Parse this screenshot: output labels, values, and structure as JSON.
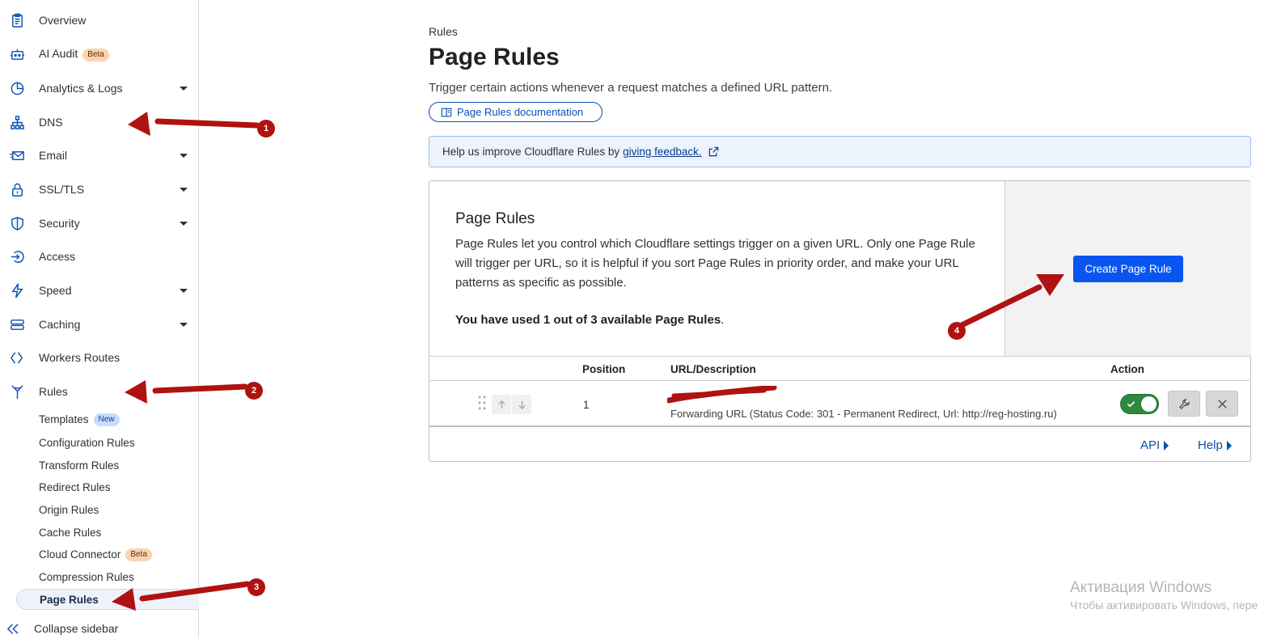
{
  "sidebar": {
    "items": [
      {
        "label": "Overview",
        "icon": "clipboard-icon"
      },
      {
        "label": "AI Audit",
        "icon": "robot-icon",
        "badge": "Beta"
      },
      {
        "label": "Analytics & Logs",
        "icon": "pie-chart-icon",
        "caret": true
      },
      {
        "label": "DNS",
        "icon": "network-icon",
        "caret": true
      },
      {
        "label": "Email",
        "icon": "envelope-icon",
        "caret": true
      },
      {
        "label": "SSL/TLS",
        "icon": "lock-icon",
        "caret": true
      },
      {
        "label": "Security",
        "icon": "shield-icon",
        "caret": true
      },
      {
        "label": "Access",
        "icon": "access-icon"
      },
      {
        "label": "Speed",
        "icon": "lightning-icon",
        "caret": true
      },
      {
        "label": "Caching",
        "icon": "storage-icon",
        "caret": true
      },
      {
        "label": "Workers Routes",
        "icon": "workers-icon"
      },
      {
        "label": "Rules",
        "icon": "rules-icon"
      }
    ],
    "subitems": [
      {
        "label": "Templates",
        "badge": "New"
      },
      {
        "label": "Configuration Rules"
      },
      {
        "label": "Transform Rules"
      },
      {
        "label": "Redirect Rules"
      },
      {
        "label": "Origin Rules"
      },
      {
        "label": "Cache Rules"
      },
      {
        "label": "Cloud Connector",
        "badge": "Beta"
      },
      {
        "label": "Compression Rules"
      },
      {
        "label": "Page Rules",
        "active": true
      }
    ],
    "collapse_label": "Collapse sidebar"
  },
  "header": {
    "breadcrumb": "Rules",
    "title": "Page Rules",
    "subtitle": "Trigger certain actions whenever a request matches a defined URL pattern.",
    "doc_button": "Page Rules documentation"
  },
  "feedback": {
    "text": "Help us improve Cloudflare Rules by",
    "link": "giving feedback."
  },
  "card": {
    "title": "Page Rules",
    "description": "Page Rules let you control which Cloudflare settings trigger on a given URL. Only one Page Rule will trigger per URL, so it is helpful if you sort Page Rules in priority order, and make your URL patterns as specific as possible.",
    "usage_bold": "You have used 1 out of 3 available Page Rules",
    "usage_end": ".",
    "create_button": "Create Page Rule"
  },
  "table": {
    "headers": {
      "position": "Position",
      "url": "URL/Description",
      "action": "Action"
    },
    "rows": [
      {
        "position": "1",
        "url": "",
        "description": "Forwarding URL (Status Code: 301 - Permanent Redirect, Url: http://reg-hosting.ru)",
        "enabled": true
      }
    ]
  },
  "footer_links": {
    "api": "API",
    "help": "Help"
  },
  "watermark": {
    "line1": "Активация Windows",
    "line2": "Чтобы активировать Windows, пере"
  },
  "annotations": [
    "1",
    "2",
    "3",
    "4"
  ],
  "colors": {
    "primary": "#0855f0",
    "link": "#0a4fb3",
    "toggle_on": "#2d8a3c",
    "annotation": "#b01212"
  }
}
